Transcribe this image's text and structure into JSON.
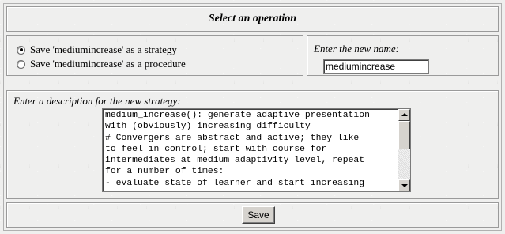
{
  "header": {
    "title": "Select an operation"
  },
  "options": {
    "items": [
      {
        "label": "Save 'mediumincrease' as a strategy",
        "checked": true
      },
      {
        "label": "Save 'mediumincrease' as a procedure",
        "checked": false
      }
    ]
  },
  "name_field": {
    "label": "Enter the new name:",
    "value": "mediumincrease"
  },
  "description": {
    "label": "Enter a description for the new strategy:",
    "value": "medium_increase(): generate adaptive presentation\nwith (obviously) increasing difficulty\n# Convergers are abstract and active; they like\nto feel in control; start with course for\nintermediates at medium adaptivity level, repeat\nfor a number of times:\n- evaluate state of learner and start increasing"
  },
  "actions": {
    "save_label": "Save"
  }
}
